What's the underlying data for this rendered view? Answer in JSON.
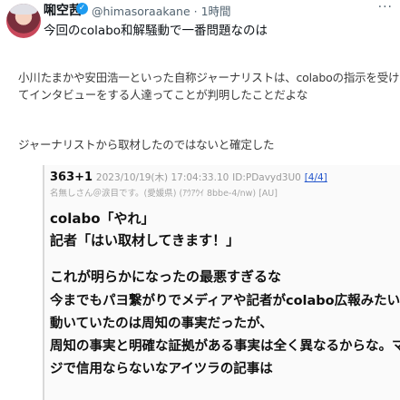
{
  "tweet": {
    "display_name": "啝空茜",
    "handle": "@himasoraakane",
    "time": "· 1時間",
    "more": "···",
    "text": "今回のcolabo和解騒動で一番問題なのは"
  },
  "quote": {
    "line1": "小川たまかや安田浩一といった自称ジャーナリストは、colaboの指示を受け",
    "line2": "てインタビューをする人達ってことが判明したことだよな",
    "line3": "ジャーナリストから取材したのではないと確定した"
  },
  "post": {
    "number": "363+1",
    "date": "2023/10/19(木) 17:04:33.10",
    "id": "ID:PDavyd3U0",
    "link": "[4/4]",
    "name_line": "名無しさん＠涙目です。(愛媛県) (ｱｳｱｳｲ 8bbe-4/nw) [AU]",
    "lines": [
      "colabo「やれ」",
      "記者「はい取材してきます！」",
      "これが明らかになったの最悪すぎるな",
      "今までもパヨ繋がりでメディアや記者がcolabo広報みたいに",
      "動いていたのは周知の事実だったが、",
      "周知の事実と明確な証拠がある事実は全く異なるからな。マ",
      "ジで信用ならないなアイツラの記事は"
    ]
  },
  "colors": {
    "accent": "#1d9bf0",
    "muted": "#536471"
  }
}
